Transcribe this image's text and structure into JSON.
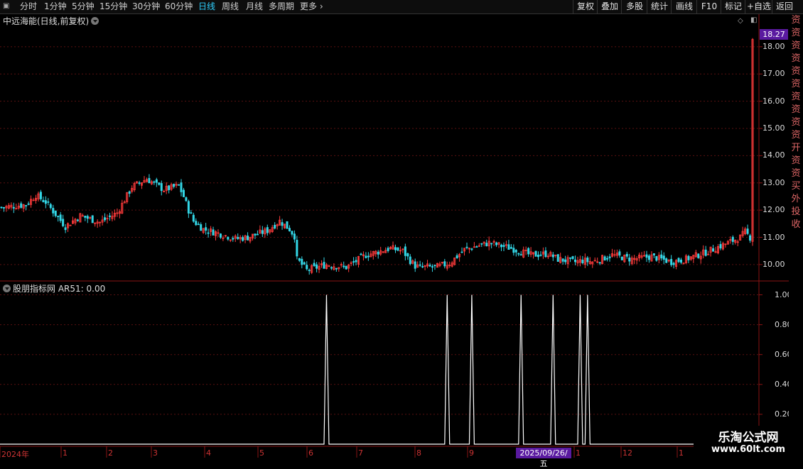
{
  "toolbar": {
    "periods": [
      "分时",
      "1分钟",
      "5分钟",
      "15分钟",
      "30分钟",
      "60分钟",
      "日线",
      "周线",
      "月线",
      "多周期",
      "更多"
    ],
    "active_period": "日线",
    "right_buttons": [
      "复权",
      "叠加",
      "多股",
      "统计",
      "画线",
      "F10",
      "标记",
      "+自选",
      "返回"
    ]
  },
  "main_chart": {
    "title": "中远海能(日线,前复权)",
    "last_price_tag": "18.27"
  },
  "indicator": {
    "title": "股朋指标网  AR51: 0.00"
  },
  "x_axis": {
    "labels": [
      "2024年",
      "1",
      "2",
      "3",
      "4",
      "5",
      "6",
      "7",
      "8",
      "9",
      "1",
      "12",
      "1"
    ],
    "highlight_date": "2025/09/26/五"
  },
  "right_strip_chars": [
    "资",
    "资",
    "资",
    "资",
    "资",
    "资",
    "资",
    "资",
    "资",
    "资",
    "开",
    "资",
    "资",
    "买",
    "外",
    "投",
    "收"
  ],
  "watermark": {
    "title": "乐淘公式网",
    "url": "www.60lt.com"
  },
  "colors": {
    "up": "#ff3b3b",
    "down": "#33d6e6",
    "grid": "#5a1010",
    "axis": "#8a1515",
    "signal": "#ffffff"
  },
  "chart_data": [
    {
      "type": "candlestick",
      "title": "中远海能(日线,前复权)",
      "ylim": [
        9.45,
        18.7
      ],
      "yticks": [
        10.0,
        11.0,
        12.0,
        13.0,
        14.0,
        15.0,
        16.0,
        17.0,
        18.0
      ],
      "ytick_labels": [
        "10.00",
        "11.00",
        "12.00",
        "13.00",
        "14.00",
        "15.00",
        "16.00",
        "17.00",
        "18.00"
      ],
      "last_price": 18.27,
      "close_path_days": [
        0,
        10,
        14,
        18,
        26,
        32,
        40,
        47,
        53,
        59,
        66,
        72,
        74,
        76,
        78,
        82,
        88,
        95,
        100,
        108,
        113,
        117,
        119,
        120,
        124,
        132,
        140,
        148,
        158,
        163,
        166,
        168,
        170,
        173,
        176,
        182,
        188,
        198,
        207,
        215,
        222,
        226,
        233,
        236,
        240,
        248,
        256,
        264,
        272,
        278,
        286,
        295,
        300,
        302,
        305
      ],
      "close_path_prices": [
        12.1,
        12.2,
        12.55,
        12.3,
        11.4,
        11.8,
        11.55,
        11.9,
        12.85,
        13.15,
        12.75,
        12.9,
        12.5,
        12.0,
        11.6,
        11.3,
        11.15,
        10.95,
        11.0,
        11.25,
        11.6,
        11.3,
        11.05,
        10.2,
        9.8,
        10.0,
        9.9,
        10.35,
        10.6,
        10.5,
        10.15,
        9.95,
        9.9,
        9.92,
        9.9,
        10.05,
        10.55,
        10.8,
        10.6,
        10.35,
        10.4,
        10.2,
        10.1,
        10.15,
        10.1,
        10.35,
        10.2,
        10.3,
        10.1,
        10.2,
        10.45,
        10.8,
        11.0,
        11.2,
        10.9
      ]
    },
    {
      "type": "line",
      "title": "股朋指标网  AR51: 0.00",
      "series": [
        {
          "name": "AR51",
          "signal_bar_indices": [
            132,
            181,
            191,
            211,
            224,
            235,
            238
          ]
        }
      ],
      "ylim": [
        0,
        1.05
      ],
      "yticks": [
        0.2,
        0.4,
        0.6,
        0.8,
        1.0
      ],
      "ytick_labels": [
        "0.20",
        "0.40",
        "0.60",
        "0.80",
        "1.00"
      ]
    }
  ]
}
